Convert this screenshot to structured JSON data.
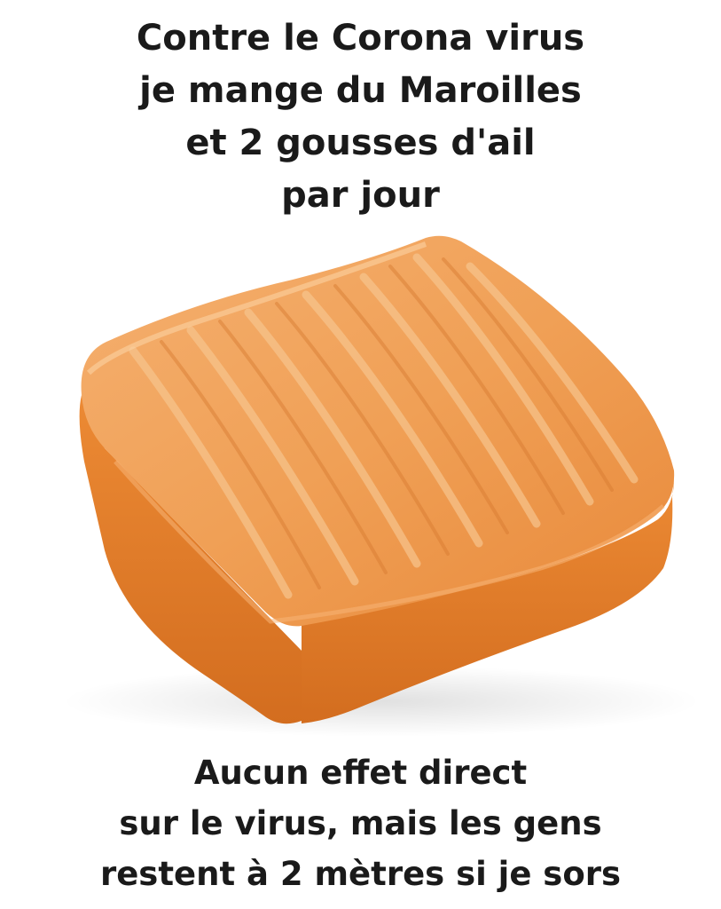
{
  "meme": {
    "top_caption": [
      "Contre le Corona virus",
      "je mange du Maroilles",
      "et 2 gousses d'ail",
      "par jour"
    ],
    "bottom_caption": [
      "Aucun effet direct",
      "sur le virus, mais les gens",
      "restent à 2 mètres si je sors"
    ],
    "colors": {
      "background": "#ffffff",
      "text": "#1a1a1a",
      "cheese_top": "#f0a35c",
      "cheese_side": "#e07a2a",
      "cheese_shadow": "#b8561a"
    }
  }
}
